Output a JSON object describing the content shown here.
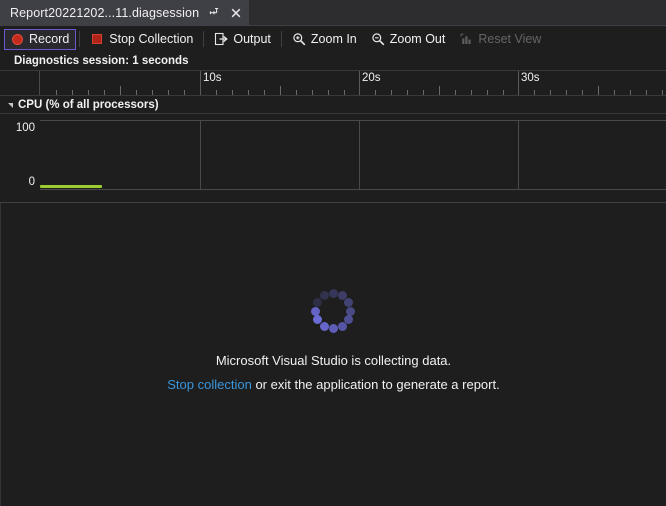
{
  "tab": {
    "title": "Report20221202...11.diagsession",
    "pin_icon": "pin-icon",
    "close_icon": "close-icon"
  },
  "toolbar": {
    "record_label": "Record",
    "stop_collection_label": "Stop Collection",
    "output_label": "Output",
    "zoom_in_label": "Zoom In",
    "zoom_out_label": "Zoom Out",
    "reset_view_label": "Reset View"
  },
  "session": {
    "label": "Diagnostics session: 1 seconds"
  },
  "cpu": {
    "title": "CPU (% of all processors)",
    "y_max": "100",
    "y_min": "0"
  },
  "status": {
    "collecting_message": "Microsoft Visual Studio is collecting data.",
    "stop_link": "Stop collection",
    "tail_message": " or exit the application to generate a report."
  },
  "colors": {
    "record_red": "#c42b1c",
    "focus_purple": "#6a5acd",
    "link_blue": "#3a96dd",
    "cpu_green": "#9acd32",
    "spinner_purple": "#6b6bd6",
    "background": "#1e1e1e",
    "tab_background": "#3f3f46"
  },
  "chart_data": {
    "type": "area",
    "title": "CPU (% of all processors)",
    "xlabel": "",
    "ylabel": "% of all processors",
    "ylim": [
      0,
      100
    ],
    "xlim": [
      0,
      40
    ],
    "yticks": [
      "0",
      "100"
    ],
    "xticks": [
      "10s",
      "20s",
      "30s"
    ],
    "xtick_values": [
      10,
      20,
      30
    ],
    "grid": true,
    "legend": "none",
    "series": [
      {
        "name": "CPU",
        "color": "#9acd32",
        "x": [
          0,
          0.25,
          0.5,
          0.75,
          1.0
        ],
        "values": [
          1,
          2,
          2,
          1,
          1
        ]
      }
    ]
  }
}
